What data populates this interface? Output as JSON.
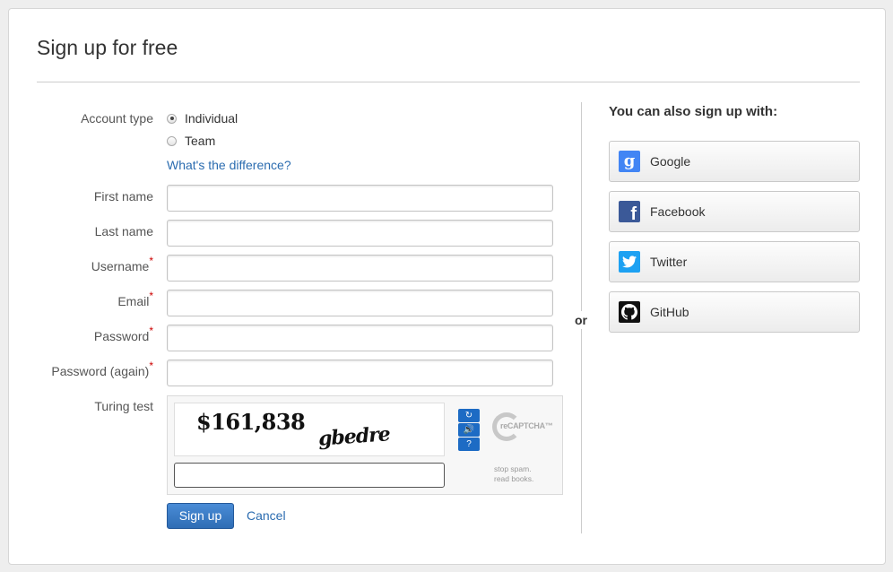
{
  "form": {
    "title": "Sign up for free",
    "account_type_label": "Account type",
    "account_options": [
      "Individual",
      "Team"
    ],
    "selected_account": "Individual",
    "difference_link": "What's the difference?",
    "first_name_label": "First name",
    "last_name_label": "Last name",
    "username_label": "Username",
    "email_label": "Email",
    "password_label": "Password",
    "password_again_label": "Password (again)",
    "required_marker": "*",
    "turing_label": "Turing test",
    "captcha": {
      "text1": "$161,838",
      "text2": "gbedre",
      "logo_text": "reCAPTCHA™",
      "tagline_line1": "stop spam.",
      "tagline_line2": "read books.",
      "refresh_icon": "↻",
      "audio_icon": "🔊",
      "help_icon": "?"
    },
    "signup_button": "Sign up",
    "cancel_link": "Cancel"
  },
  "divider_text": "or",
  "social": {
    "heading": "You can also sign up with:",
    "providers": [
      {
        "name": "Google",
        "icon": "google-icon",
        "color": "#4285f4"
      },
      {
        "name": "Facebook",
        "icon": "facebook-icon",
        "color": "#3b5998"
      },
      {
        "name": "Twitter",
        "icon": "twitter-icon",
        "color": "#1da1f2"
      },
      {
        "name": "GitHub",
        "icon": "github-icon",
        "color": "#111111"
      }
    ]
  },
  "colors": {
    "link": "#2b6cb0",
    "primary_button": "#2f6db5",
    "required": "#cc0000"
  }
}
